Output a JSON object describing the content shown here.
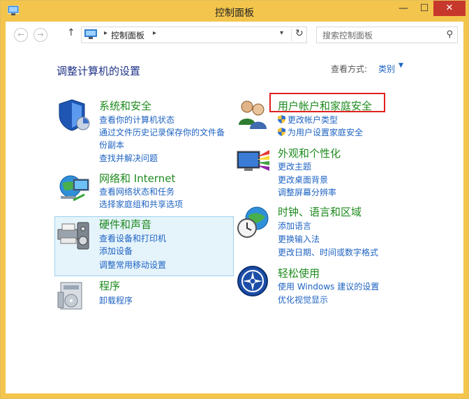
{
  "window": {
    "title": "控制面板"
  },
  "navbar": {
    "address": "控制面板",
    "search_placeholder": "搜索控制面板"
  },
  "main": {
    "heading": "调整计算机的设置",
    "view_label": "查看方式:",
    "view_value": "类别"
  },
  "categories": [
    {
      "title": "系统和安全",
      "links": [
        "查看你的计算机状态",
        "通过文件历史记录保存你的文件备",
        "份副本",
        "查找并解决问题"
      ]
    },
    {
      "title": "网络和 Internet",
      "links": [
        "查看网络状态和任务",
        "选择家庭组和共享选项"
      ]
    },
    {
      "title": "硬件和声音",
      "links": [
        "查看设备和打印机",
        "添加设备",
        "调整常用移动设置"
      ]
    },
    {
      "title": "程序",
      "links": [
        "卸载程序"
      ]
    },
    {
      "title": "用户帐户和家庭安全",
      "links": [
        "更改帐户类型",
        "为用户设置家庭安全"
      ]
    },
    {
      "title": "外观和个性化",
      "links": [
        "更改主题",
        "更改桌面背景",
        "调整屏幕分辨率"
      ]
    },
    {
      "title": "时钟、语言和区域",
      "links": [
        "添加语言",
        "更换输入法",
        "更改日期、时间或数字格式"
      ]
    },
    {
      "title": "轻松使用",
      "links": [
        "使用 Windows 建议的设置",
        "优化视觉显示"
      ]
    }
  ],
  "colors": {
    "title_bar": "#f3c54c",
    "link": "#1e63c2",
    "category_title": "#1d8a1d",
    "heading": "#1e3287",
    "highlight_border": "#e02020"
  }
}
